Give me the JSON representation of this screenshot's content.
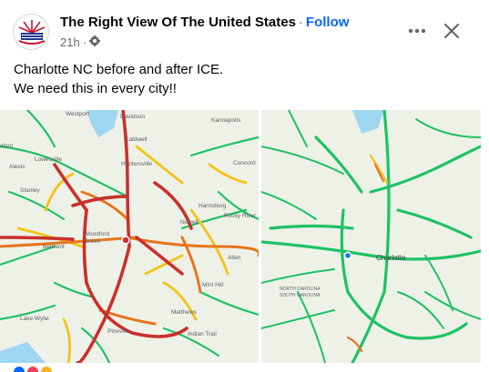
{
  "post": {
    "page_name": "The Right View Of The United States",
    "separator": "·",
    "follow_label": "Follow",
    "time": "21h",
    "dot": "·",
    "audience_icon": "globe-icon",
    "lines": [
      "Charlotte NC before and after ICE.",
      "We need this in every city!!"
    ]
  },
  "header_icons": {
    "more": "more-options-icon",
    "close": "close-icon"
  },
  "maps": {
    "before": {
      "labels": [
        "Westport",
        "Davidson",
        "Kannapolis",
        "Caldwell",
        "Lowesville",
        "Huntersville",
        "Concord",
        "Alexis",
        "Stanley",
        "Harrisburg",
        "Rocky River",
        "Newell",
        "Woodford Green",
        "Belmont",
        "Allen",
        "Mint Hill",
        "Matthews",
        "Lake Wylie",
        "Pineville",
        "Indian Trail",
        "ation"
      ]
    },
    "after": {
      "labels": [
        "Charlotte",
        "NORTH CAROLINA",
        "SOUTH CAROLINA"
      ]
    }
  },
  "colors": {
    "accent": "#0866ff",
    "traffic_green": "#1ec264",
    "traffic_yellow": "#f3c316",
    "traffic_orange": "#e8741c",
    "traffic_red": "#c9302c",
    "water": "#9fd6f2"
  }
}
